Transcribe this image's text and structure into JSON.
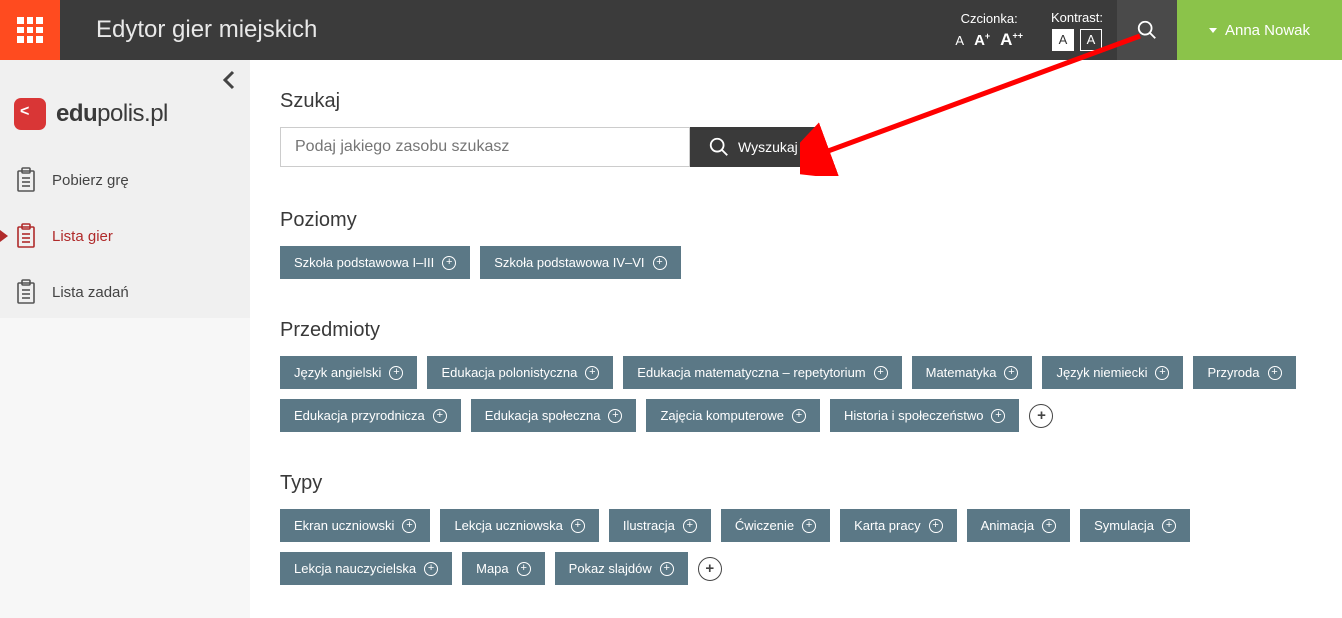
{
  "header": {
    "title": "Edytor gier miejskich",
    "font_label": "Czcionka:",
    "contrast_label": "Kontrast:",
    "contrast_light": "A",
    "contrast_dark": "A",
    "user_name": "Anna Nowak"
  },
  "logo": {
    "bold": "edu",
    "rest": "polis.pl"
  },
  "nav": {
    "items": [
      "Pobierz grę",
      "Lista gier",
      "Lista zadań"
    ],
    "active_index": 1
  },
  "search": {
    "title": "Szukaj",
    "placeholder": "Podaj jakiego zasobu szukasz",
    "button": "Wyszukaj"
  },
  "levels": {
    "title": "Poziomy",
    "tags": [
      "Szkoła podstawowa I–III",
      "Szkoła podstawowa IV–VI"
    ]
  },
  "subjects": {
    "title": "Przedmioty",
    "tags": [
      "Język angielski",
      "Edukacja polonistyczna",
      "Edukacja matematyczna – repetytorium",
      "Matematyka",
      "Język niemiecki",
      "Przyroda",
      "Edukacja przyrodnicza",
      "Edukacja społeczna",
      "Zajęcia komputerowe",
      "Historia i społeczeństwo"
    ],
    "has_more": true
  },
  "types": {
    "title": "Typy",
    "tags": [
      "Ekran uczniowski",
      "Lekcja uczniowska",
      "Ilustracja",
      "Ćwiczenie",
      "Karta pracy",
      "Animacja",
      "Symulacja",
      "Lekcja nauczycielska",
      "Mapa",
      "Pokaz slajdów"
    ],
    "has_more": true
  }
}
